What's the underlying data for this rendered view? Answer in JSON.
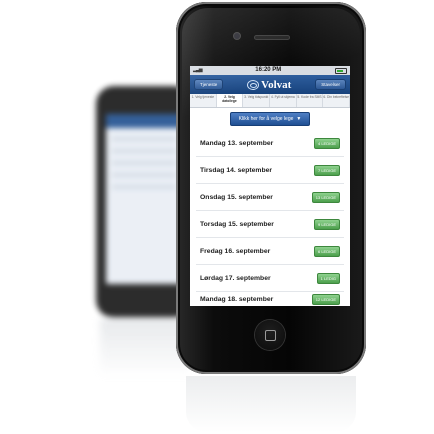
{
  "status": {
    "time": "16:20 PM"
  },
  "header": {
    "left_button": "Tjeneste",
    "logo": "Volvat",
    "right_button": "Stavelser"
  },
  "steps": [
    "1. Velg tjeneste",
    "2. Velg dato/lege",
    "3. Velg tidspunkt",
    "4. Fyll ut skjema",
    "5. Kode fra SMS",
    "6. Din bekreftelse"
  ],
  "select_button": {
    "label": "Klikk her for å velge lege"
  },
  "days": [
    {
      "name": "Mandag 13. september",
      "badge": "4 LEDIGE"
    },
    {
      "name": "Tirsdag 14. september",
      "badge": "7 LEDIGE"
    },
    {
      "name": "Onsdag 15. september",
      "badge": "13 LEDIGE"
    },
    {
      "name": "Torsdag 15. september",
      "badge": "9 LEDIGE"
    },
    {
      "name": "Fredag 16. september",
      "badge": "6 LEDIGE"
    },
    {
      "name": "Lørdag 17. september",
      "badge": "1 LEDIG"
    },
    {
      "name": "Mandag 18. september",
      "badge": "12 LEDIGE"
    }
  ],
  "colors": {
    "header_blue": "#17427c",
    "badge_green": "#4c9f4c"
  }
}
